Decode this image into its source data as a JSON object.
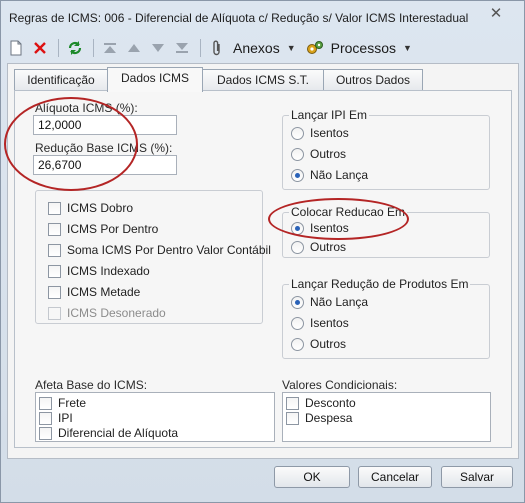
{
  "window": {
    "title": "Regras de ICMS: 006 - Diferencial de Alíquota c/ Redução s/ Valor ICMS Interestadual",
    "close_icon": "x-icon"
  },
  "toolbar": {
    "anexos_label": "Anexos",
    "processos_label": "Processos"
  },
  "tabs": [
    "Identificação",
    "Dados ICMS",
    "Dados ICMS S.T.",
    "Outros Dados"
  ],
  "fields": {
    "aliquota_label": "Alíquota ICMS (%):",
    "aliquota_value": "12,0000",
    "reducao_label": "Redução Base ICMS (%):",
    "reducao_value": "26,6700"
  },
  "icms_options": [
    {
      "label": "ICMS Dobro",
      "checked": false,
      "disabled": false
    },
    {
      "label": "ICMS Por Dentro",
      "checked": false,
      "disabled": false
    },
    {
      "label": "Soma ICMS Por Dentro Valor Contábil",
      "checked": false,
      "disabled": false
    },
    {
      "label": "ICMS Indexado",
      "checked": false,
      "disabled": false
    },
    {
      "label": "ICMS Metade",
      "checked": false,
      "disabled": false
    },
    {
      "label": "ICMS Desonerado",
      "checked": false,
      "disabled": true
    }
  ],
  "lancar_ipi": {
    "title": "Lançar IPI Em",
    "options": [
      "Isentos",
      "Outros",
      "Não Lança"
    ],
    "selected": "Não Lança"
  },
  "colocar_reducao": {
    "title": "Colocar Reducao Em",
    "options": [
      "Isentos",
      "Outros"
    ],
    "selected": "Isentos"
  },
  "lancar_reducao_produtos": {
    "title": "Lançar Redução de Produtos Em",
    "options": [
      "Não Lança",
      "Isentos",
      "Outros"
    ],
    "selected": "Não Lança"
  },
  "afeta_base": {
    "label": "Afeta Base do ICMS:",
    "items": [
      "Frete",
      "IPI",
      "Diferencial de Alíquota"
    ]
  },
  "valores_condicionais": {
    "label": "Valores Condicionais:",
    "items": [
      "Desconto",
      "Despesa"
    ]
  },
  "buttons": {
    "ok": "OK",
    "cancelar": "Cancelar",
    "salvar": "Salvar"
  },
  "colors": {
    "annotation": "#b42525",
    "radio_selected": "#2a62b8"
  }
}
